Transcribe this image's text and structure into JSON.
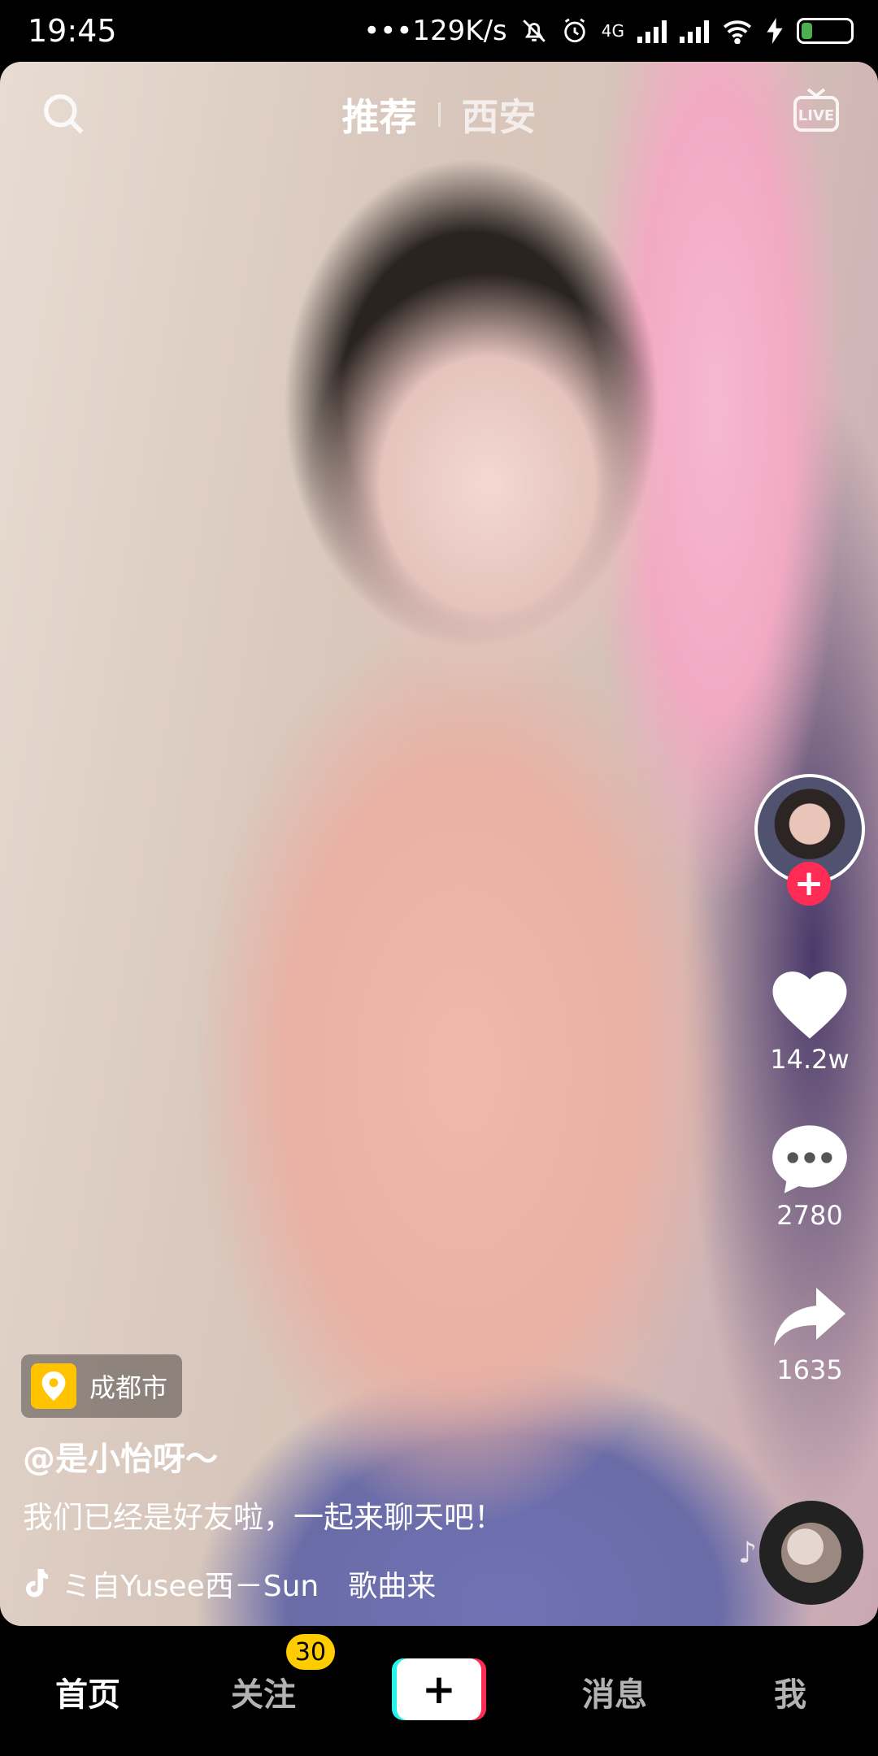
{
  "status_bar": {
    "time": "19:45",
    "network_speed": "•••129K/s",
    "network_type": "4G",
    "battery": "29",
    "icons": [
      "mute-icon",
      "alarm-icon",
      "signal-icon",
      "signal-icon",
      "wifi-icon",
      "charging-icon",
      "battery-icon"
    ]
  },
  "top_nav": {
    "tabs": [
      {
        "label": "推荐",
        "active": true
      },
      {
        "label": "西安",
        "active": false
      }
    ],
    "search_icon": "search-icon",
    "live_icon": "live-icon",
    "live_label": "LIVE"
  },
  "side_actions": {
    "like_count": "14.2w",
    "comment_count": "2780",
    "share_count": "1635"
  },
  "video_info": {
    "location": "成都市",
    "username": "@是小怡呀～",
    "caption": "我们已经是好友啦，一起来聊天吧！",
    "music": "ミ自Yusee西－Sun　歌曲来"
  },
  "bottom_nav": {
    "items": [
      {
        "label": "首页",
        "active": true
      },
      {
        "label": "关注",
        "active": false
      },
      {
        "label": "消息",
        "active": false
      },
      {
        "label": "我",
        "active": false
      }
    ],
    "follow_badge": "30",
    "create_symbol": "+"
  },
  "colors": {
    "accent_red": "#fe2c55",
    "accent_cyan": "#25f4ee",
    "badge_yellow": "#ffcc00",
    "location_yellow": "#ffc300"
  }
}
